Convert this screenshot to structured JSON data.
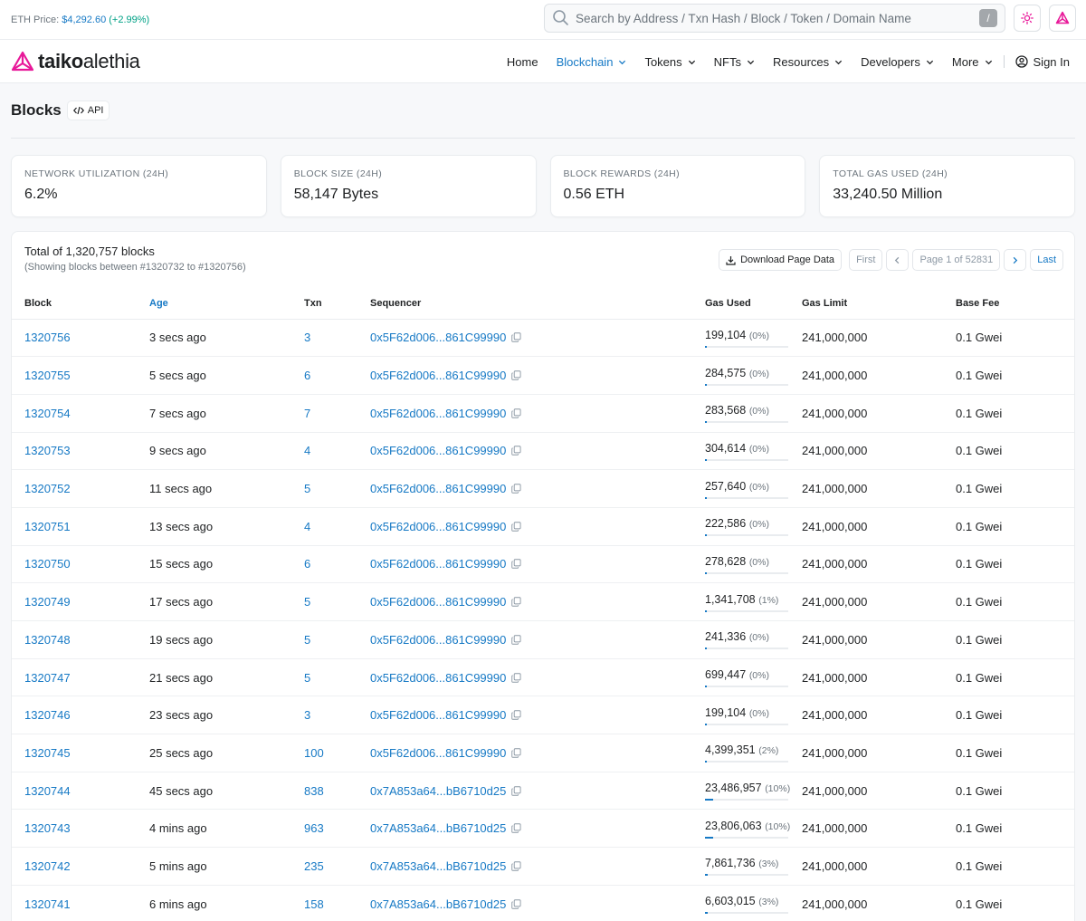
{
  "topbar": {
    "eth_price_label": "ETH Price:",
    "eth_price_value": "$4,292.60",
    "eth_price_change": "(+2.99%)",
    "search_placeholder": "Search by Address / Txn Hash / Block / Token / Domain Name",
    "search_shortcut": "/"
  },
  "logo": {
    "word1": "taiko",
    "word2": "alethia",
    "brand_color": "#e81899"
  },
  "nav": {
    "items": [
      {
        "label": "Home"
      },
      {
        "label": "Blockchain"
      },
      {
        "label": "Tokens"
      },
      {
        "label": "NFTs"
      },
      {
        "label": "Resources"
      },
      {
        "label": "Developers"
      },
      {
        "label": "More"
      }
    ],
    "sign_in": "Sign In"
  },
  "page": {
    "title": "Blocks",
    "api_label": "API"
  },
  "stats": [
    {
      "label": "NETWORK UTILIZATION (24H)",
      "value": "6.2%"
    },
    {
      "label": "BLOCK SIZE (24H)",
      "value": "58,147 Bytes"
    },
    {
      "label": "BLOCK REWARDS (24H)",
      "value": "0.56 ETH"
    },
    {
      "label": "TOTAL GAS USED (24H)",
      "value": "33,240.50 Million"
    }
  ],
  "table_header": {
    "total": "Total of 1,320,757 blocks",
    "showing": "(Showing blocks between #1320732 to #1320756)",
    "download": "Download Page Data",
    "first": "First",
    "page": "Page 1 of 52831",
    "last": "Last"
  },
  "columns": {
    "block": "Block",
    "age": "Age",
    "txn": "Txn",
    "sequencer": "Sequencer",
    "gas_used": "Gas Used",
    "gas_limit": "Gas Limit",
    "base_fee": "Base Fee"
  },
  "rows": [
    {
      "block": "1320756",
      "age": "3 secs ago",
      "txn": "3",
      "sequencer": "0x5F62d006...861C99990",
      "gas": "199,104",
      "pct": "(0%)",
      "pct_value": 0,
      "limit": "241,000,000",
      "fee": "0.1 Gwei"
    },
    {
      "block": "1320755",
      "age": "5 secs ago",
      "txn": "6",
      "sequencer": "0x5F62d006...861C99990",
      "gas": "284,575",
      "pct": "(0%)",
      "pct_value": 0,
      "limit": "241,000,000",
      "fee": "0.1 Gwei"
    },
    {
      "block": "1320754",
      "age": "7 secs ago",
      "txn": "7",
      "sequencer": "0x5F62d006...861C99990",
      "gas": "283,568",
      "pct": "(0%)",
      "pct_value": 0,
      "limit": "241,000,000",
      "fee": "0.1 Gwei"
    },
    {
      "block": "1320753",
      "age": "9 secs ago",
      "txn": "4",
      "sequencer": "0x5F62d006...861C99990",
      "gas": "304,614",
      "pct": "(0%)",
      "pct_value": 0,
      "limit": "241,000,000",
      "fee": "0.1 Gwei"
    },
    {
      "block": "1320752",
      "age": "11 secs ago",
      "txn": "5",
      "sequencer": "0x5F62d006...861C99990",
      "gas": "257,640",
      "pct": "(0%)",
      "pct_value": 0,
      "limit": "241,000,000",
      "fee": "0.1 Gwei"
    },
    {
      "block": "1320751",
      "age": "13 secs ago",
      "txn": "4",
      "sequencer": "0x5F62d006...861C99990",
      "gas": "222,586",
      "pct": "(0%)",
      "pct_value": 0,
      "limit": "241,000,000",
      "fee": "0.1 Gwei"
    },
    {
      "block": "1320750",
      "age": "15 secs ago",
      "txn": "6",
      "sequencer": "0x5F62d006...861C99990",
      "gas": "278,628",
      "pct": "(0%)",
      "pct_value": 0,
      "limit": "241,000,000",
      "fee": "0.1 Gwei"
    },
    {
      "block": "1320749",
      "age": "17 secs ago",
      "txn": "5",
      "sequencer": "0x5F62d006...861C99990",
      "gas": "1,341,708",
      "pct": "(1%)",
      "pct_value": 1,
      "limit": "241,000,000",
      "fee": "0.1 Gwei"
    },
    {
      "block": "1320748",
      "age": "19 secs ago",
      "txn": "5",
      "sequencer": "0x5F62d006...861C99990",
      "gas": "241,336",
      "pct": "(0%)",
      "pct_value": 0,
      "limit": "241,000,000",
      "fee": "0.1 Gwei"
    },
    {
      "block": "1320747",
      "age": "21 secs ago",
      "txn": "5",
      "sequencer": "0x5F62d006...861C99990",
      "gas": "699,447",
      "pct": "(0%)",
      "pct_value": 0,
      "limit": "241,000,000",
      "fee": "0.1 Gwei"
    },
    {
      "block": "1320746",
      "age": "23 secs ago",
      "txn": "3",
      "sequencer": "0x5F62d006...861C99990",
      "gas": "199,104",
      "pct": "(0%)",
      "pct_value": 0,
      "limit": "241,000,000",
      "fee": "0.1 Gwei"
    },
    {
      "block": "1320745",
      "age": "25 secs ago",
      "txn": "100",
      "sequencer": "0x5F62d006...861C99990",
      "gas": "4,399,351",
      "pct": "(2%)",
      "pct_value": 2,
      "limit": "241,000,000",
      "fee": "0.1 Gwei"
    },
    {
      "block": "1320744",
      "age": "45 secs ago",
      "txn": "838",
      "sequencer": "0x7A853a64...bB6710d25",
      "gas": "23,486,957",
      "pct": "(10%)",
      "pct_value": 10,
      "limit": "241,000,000",
      "fee": "0.1 Gwei"
    },
    {
      "block": "1320743",
      "age": "4 mins ago",
      "txn": "963",
      "sequencer": "0x7A853a64...bB6710d25",
      "gas": "23,806,063",
      "pct": "(10%)",
      "pct_value": 10,
      "limit": "241,000,000",
      "fee": "0.1 Gwei"
    },
    {
      "block": "1320742",
      "age": "5 mins ago",
      "txn": "235",
      "sequencer": "0x7A853a64...bB6710d25",
      "gas": "7,861,736",
      "pct": "(3%)",
      "pct_value": 3,
      "limit": "241,000,000",
      "fee": "0.1 Gwei"
    },
    {
      "block": "1320741",
      "age": "6 mins ago",
      "txn": "158",
      "sequencer": "0x7A853a64...bB6710d25",
      "gas": "6,603,015",
      "pct": "(3%)",
      "pct_value": 3,
      "limit": "241,000,000",
      "fee": "0.1 Gwei"
    }
  ]
}
